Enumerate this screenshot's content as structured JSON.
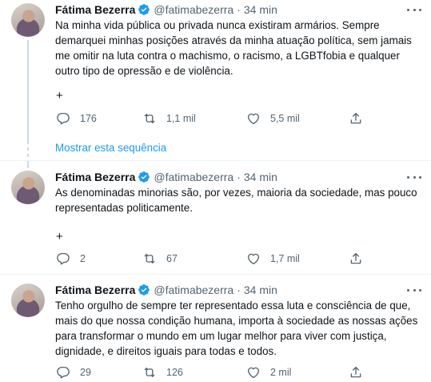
{
  "colors": {
    "accent": "#1d9bf0",
    "verified": "#1d9bf0",
    "muted": "#536471",
    "text": "#0f1419"
  },
  "show_thread_label": "Mostrar esta sequência",
  "tweets": [
    {
      "name": "Fátima Bezerra",
      "handle": "@fatimabezerra",
      "dot": "·",
      "time": "34 min",
      "lines": [
        "Na minha vida pública ou privada nunca existiram armários. Sempre",
        "demarquei minhas posições através da minha atuação política, sem jamais",
        "me omitir na luta contra o machismo, o racismo, a LGBTfobia e qualquer",
        "outro tipo de opressão e de violência."
      ],
      "plus": "+",
      "replies": "176",
      "retweets": "1,1 mil",
      "likes": "5,5 mil"
    },
    {
      "name": "Fátima Bezerra",
      "handle": "@fatimabezerra",
      "dot": "·",
      "time": "34 min",
      "lines": [
        "As denominadas minorias são, por vezes, maioria da sociedade, mas pouco",
        "representadas politicamente."
      ],
      "plus": "+",
      "replies": "2",
      "retweets": "67",
      "likes": "1,7 mil"
    },
    {
      "name": "Fátima Bezerra",
      "handle": "@fatimabezerra",
      "dot": "·",
      "time": "34 min",
      "lines": [
        "Tenho orgulho de sempre ter representado essa luta e consciência de que,",
        "mais do que nossa condição humana, importa à sociedade as nossas ações",
        "para transformar o mundo em um lugar melhor para viver com justiça,",
        "dignidade, e direitos iguais para todas e todos."
      ],
      "replies": "29",
      "retweets": "126",
      "likes": "2 mil"
    }
  ]
}
